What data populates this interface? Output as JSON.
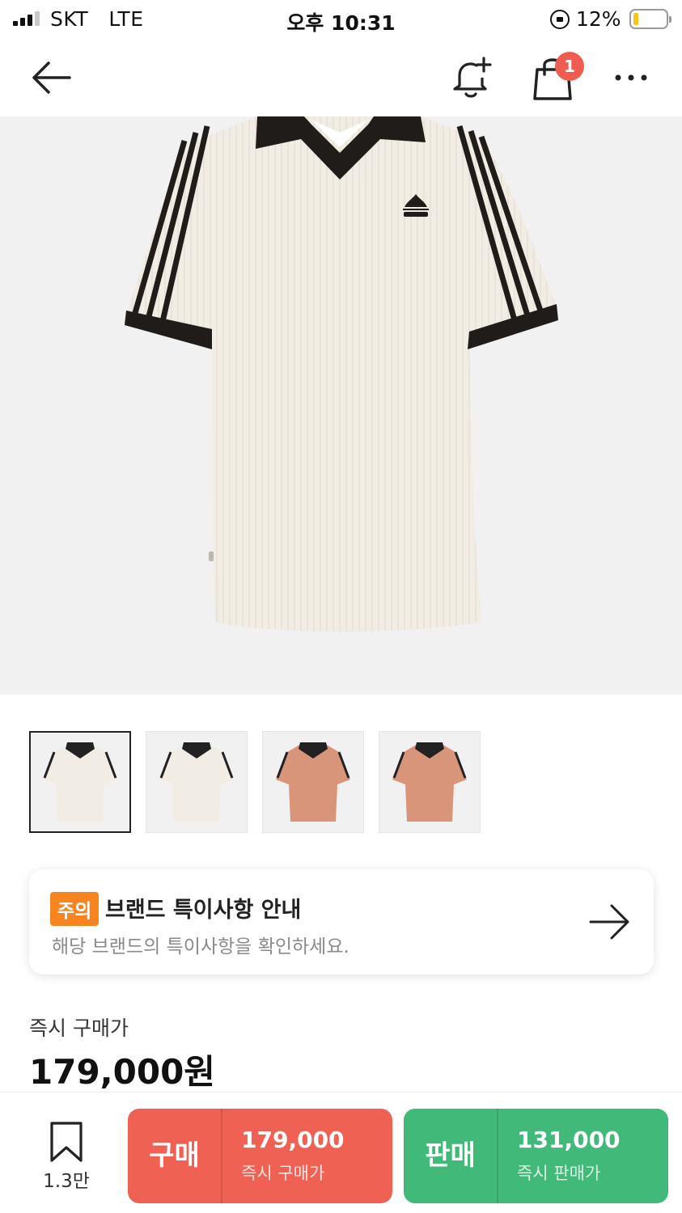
{
  "status_bar": {
    "carrier": "SKT   LTE",
    "time": "오후 10:31",
    "battery": "12%",
    "battery_level": 0.12,
    "signal_bars": 3
  },
  "nav": {
    "back_icon": "arrow-left-icon",
    "alert_icon": "bell-plus-icon",
    "cart_icon": "shopping-bag-icon",
    "cart_badge": "1",
    "more_icon": "more-horizontal-icon"
  },
  "product": {
    "image": "cream-jersey-shirt-with-black-collar",
    "thumbnails": [
      {
        "color": "cream",
        "selected": true
      },
      {
        "color": "cream",
        "selected": false
      },
      {
        "color": "peach",
        "selected": false
      },
      {
        "color": "peach",
        "selected": false
      }
    ]
  },
  "notice": {
    "badge": "주의",
    "title": "브랜드 특이사항 안내",
    "subtitle": "해당 브랜드의 특이사항을 확인하세요.",
    "arrow_icon": "arrow-right-icon"
  },
  "price": {
    "label": "즉시 구매가",
    "value": "179,000원"
  },
  "bottom_bar": {
    "wish_icon": "bookmark-icon",
    "wish_count": "1.3만",
    "buy": {
      "label": "구매",
      "amount": "179,000",
      "sub": "즉시 구매가"
    },
    "sell": {
      "label": "판매",
      "amount": "131,000",
      "sub": "즉시 판매가"
    }
  },
  "colors": {
    "buy": "#ef6253",
    "sell": "#41b979",
    "badge_orange": "#f7841e",
    "cart_badge": "#ee5d4f",
    "shirt_cream": "#f2ede4",
    "shirt_peach": "#d9957a"
  }
}
